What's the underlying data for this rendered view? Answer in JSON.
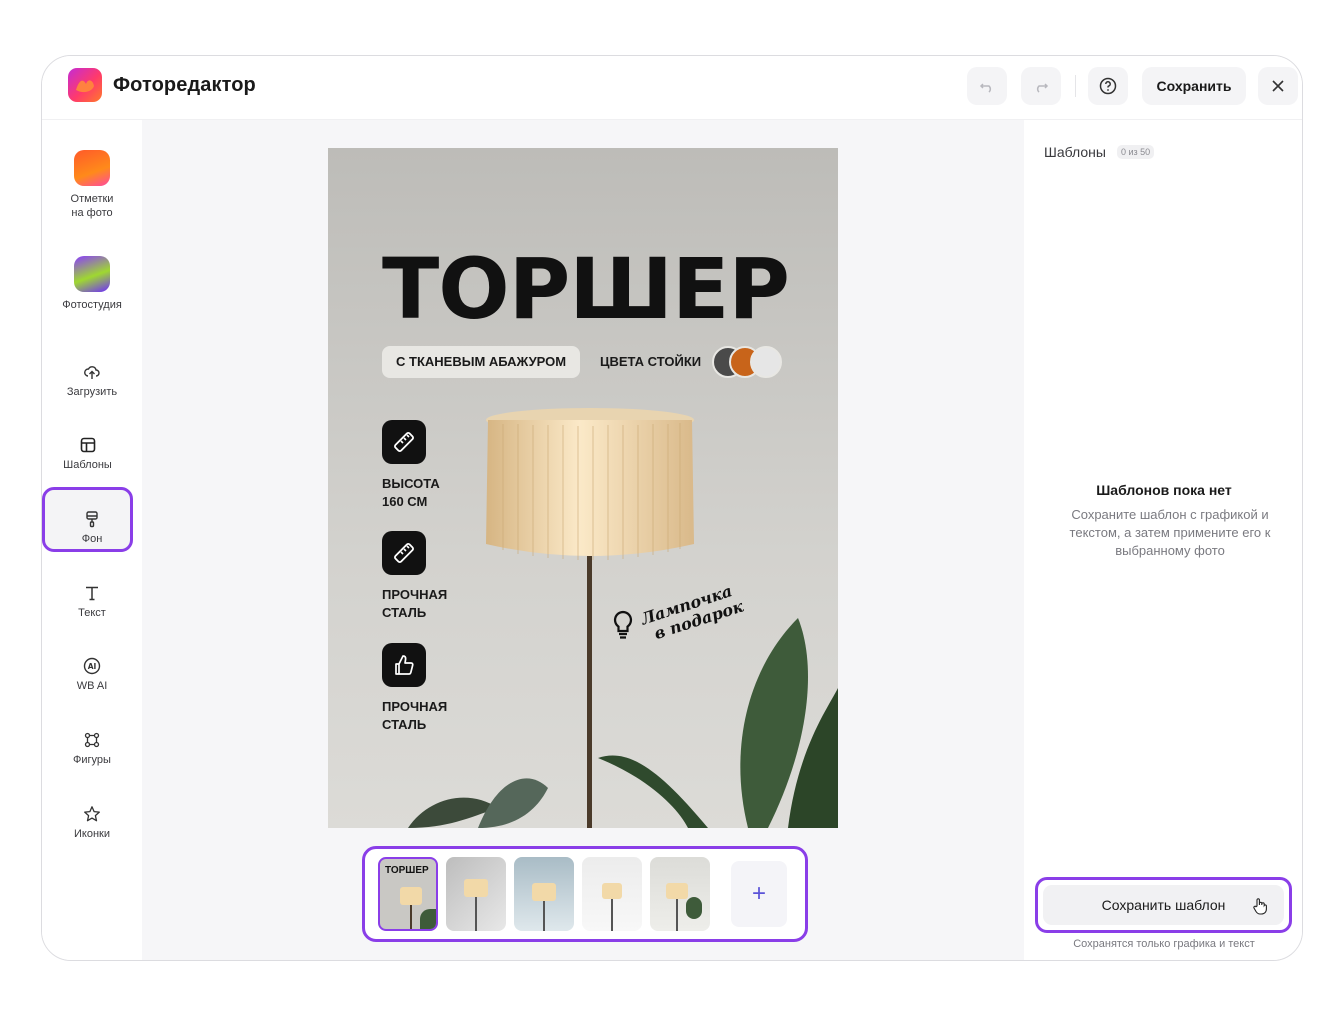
{
  "header": {
    "app_title": "Фоторедактор",
    "save_label": "Сохранить"
  },
  "sidebar": {
    "items": [
      {
        "label_line1": "Отметки",
        "label_line2": "на фото",
        "icon": "tag-tile-icon"
      },
      {
        "label": "Фотостудия",
        "icon": "photostudio-tile-icon"
      },
      {
        "label": "Загрузить",
        "icon": "upload-cloud-icon"
      },
      {
        "label": "Шаблоны",
        "icon": "template-icon",
        "active": true
      },
      {
        "label": "Фон",
        "icon": "paint-brush-icon"
      },
      {
        "label": "Текст",
        "icon": "text-t-icon"
      },
      {
        "label": "WB AI",
        "icon": "ai-icon"
      },
      {
        "label": "Фигуры",
        "icon": "shapes-icon"
      },
      {
        "label": "Иконки",
        "icon": "star-icon"
      }
    ]
  },
  "poster": {
    "title": "ТОРШЕР",
    "chip_label": "С ТКАНЕВЫМ АБАЖУРОМ",
    "colors_label": "ЦВЕТА СТОЙКИ",
    "swatch_colors": [
      "#4a4a4a",
      "#c8641a",
      "#e6e6e6"
    ],
    "features": [
      {
        "line1": "ВЫСОТА",
        "line2": "160 СМ",
        "icon": "ruler-icon"
      },
      {
        "line1": "ПРОЧНАЯ",
        "line2": "СТАЛЬ",
        "icon": "ruler-icon"
      },
      {
        "line1": "ПРОЧНАЯ",
        "line2": "СТАЛЬ",
        "icon": "thumbs-up-icon"
      }
    ],
    "bulb_line1": "Лампочка",
    "bulb_line2": "в подарок"
  },
  "thumbnails": {
    "first_thumb_title": "ТОРШЕР",
    "add_label": "+"
  },
  "right_panel": {
    "title": "Шаблоны",
    "count": "0 из 50",
    "empty_title": "Шаблонов пока нет",
    "empty_desc": "Сохраните шаблон с графикой и текстом, а затем примените его к выбранному фото",
    "save_template_label": "Сохранить шаблон",
    "save_note": "Сохранятся только графика и текст"
  },
  "colors": {
    "accent": "#8a3ee8",
    "plus": "#5a52d8"
  }
}
